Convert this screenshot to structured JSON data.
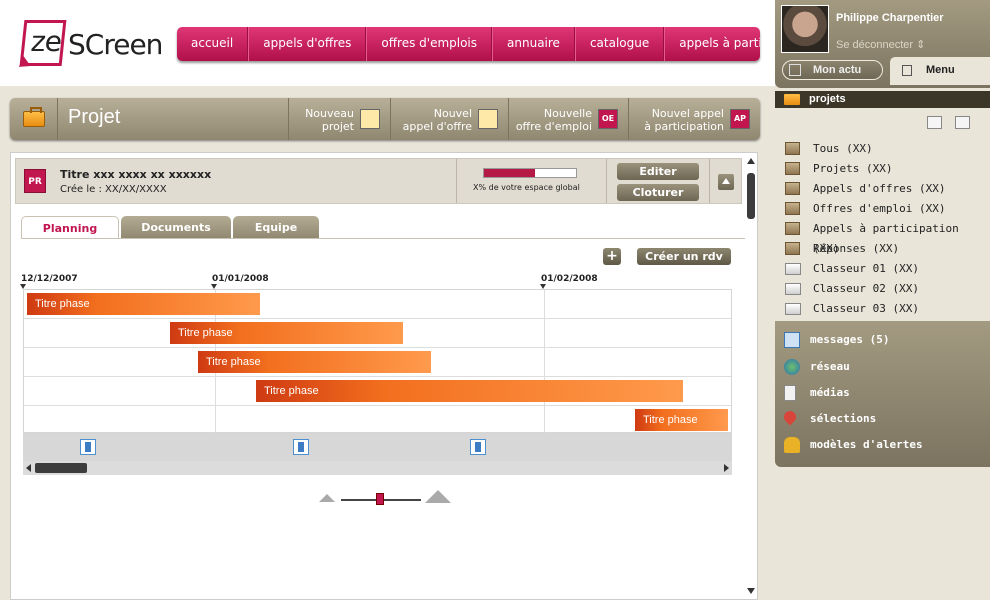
{
  "logo": {
    "mark": "ze",
    "word": "SCreen"
  },
  "topnav": [
    "accueil",
    "appels d'offres",
    "offres d'emplois",
    "annuaire",
    "catalogue",
    "appels à participation"
  ],
  "project_bar": {
    "title": "Projet",
    "buttons": [
      {
        "line1": "Nouveau",
        "line2": "projet",
        "icon": "PR"
      },
      {
        "line1": "Nouvel",
        "line2": "appel d'offre",
        "icon": "AO"
      },
      {
        "line1": "Nouvelle",
        "line2": "offre d'emploi",
        "icon": "OE"
      },
      {
        "line1": "Nouvel appel",
        "line2": "à participation",
        "icon": "AP"
      }
    ]
  },
  "project_info": {
    "badge": "PR",
    "title": "Titre xxx xxxx xx xxxxxx",
    "created": "Crée le : XX/XX/XXXX",
    "space_percent_label": "X% de votre espace global",
    "usage_fraction": 0.55,
    "edit_label": "Editer",
    "close_label": "Cloturer"
  },
  "tabs": [
    "Planning",
    "Documents",
    "Equipe"
  ],
  "active_tab": "Planning",
  "create_rdv_label": "Créer un rdv",
  "add_label": "+",
  "timeline": {
    "dates": [
      "12/12/2007",
      "01/01/2008",
      "01/02/2008"
    ],
    "phases": [
      {
        "label": "Titre phase"
      },
      {
        "label": "Titre phase"
      },
      {
        "label": "Titre phase"
      },
      {
        "label": "Titre phase"
      },
      {
        "label": "Titre phase"
      }
    ]
  },
  "user": {
    "name": "Philippe Charpentier",
    "logout": "Se déconnecter ⇕",
    "mon_actu": "Mon actu",
    "menu": "Menu"
  },
  "sidebar": {
    "section_title": "projets",
    "tree": [
      {
        "label": "Tous (XX)",
        "icon": "box-icon"
      },
      {
        "label": "Projets (XX)",
        "icon": "box-icon"
      },
      {
        "label": "Appels d'offres (XX)",
        "icon": "box-icon"
      },
      {
        "label": "Offres d'emploi (XX)",
        "icon": "box-icon"
      },
      {
        "label": "Appels à participation (XX)",
        "icon": "box-icon"
      },
      {
        "label": "Réponses (XX)",
        "icon": "box-icon"
      },
      {
        "label": "Classeur 01 (XX)",
        "icon": "folder-icon"
      },
      {
        "label": "Classeur 02 (XX)",
        "icon": "folder-icon"
      },
      {
        "label": "Classeur 03 (XX)",
        "icon": "folder-icon"
      }
    ],
    "bottom": [
      {
        "label": "messages (5)",
        "icon": "envelope-icon"
      },
      {
        "label": "réseau",
        "icon": "globe-icon"
      },
      {
        "label": "médias",
        "icon": "media-icon"
      },
      {
        "label": "sélections",
        "icon": "pin-icon"
      },
      {
        "label": "modèles d'alertes",
        "icon": "bell-icon"
      }
    ]
  },
  "colors": {
    "brand": "#c2164f",
    "bar": "#f26f1e",
    "chrome": "#8f8770"
  }
}
